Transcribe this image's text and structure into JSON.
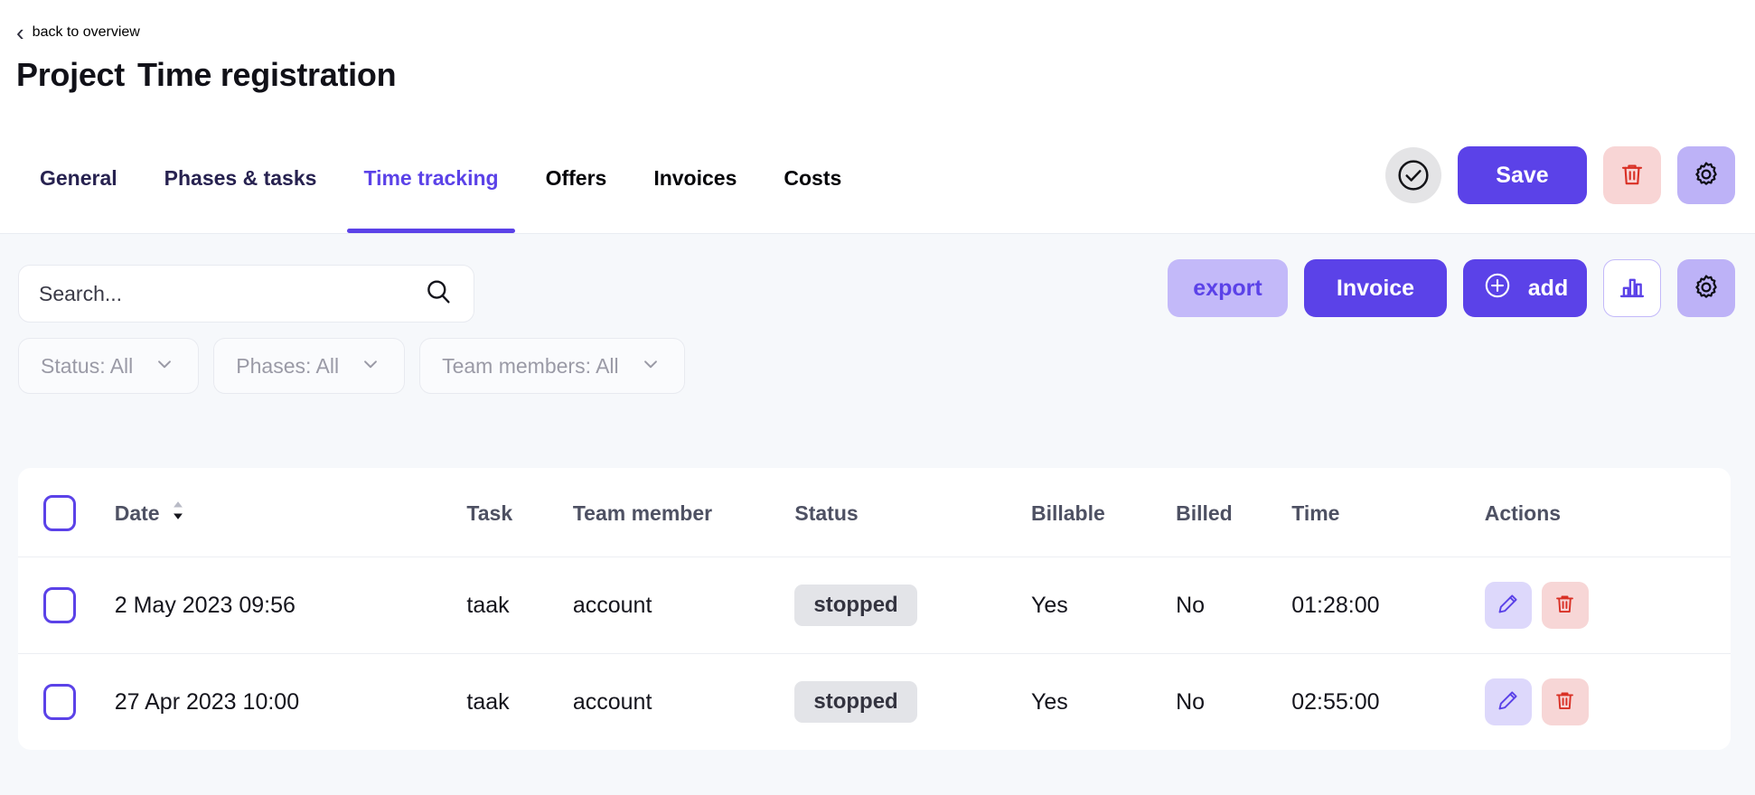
{
  "header": {
    "back_label": "back to overview",
    "back_icon": "chevron-left-icon",
    "title_prefix": "Project",
    "title_name": "Time registration",
    "tabs": [
      {
        "label": "General",
        "active": false,
        "style": "navy"
      },
      {
        "label": "Phases & tasks",
        "active": false,
        "style": "navy"
      },
      {
        "label": "Time tracking",
        "active": true,
        "style": "accent"
      },
      {
        "label": "Offers",
        "active": false,
        "style": "black"
      },
      {
        "label": "Invoices",
        "active": false,
        "style": "black"
      },
      {
        "label": "Costs",
        "active": false,
        "style": "black"
      }
    ],
    "actions": {
      "status_icon": "check-circle-icon",
      "save_label": "Save",
      "delete_icon": "trash-icon",
      "settings_icon": "gear-icon"
    }
  },
  "toolbar": {
    "search": {
      "value": "",
      "placeholder": "Search...",
      "icon": "search-icon"
    },
    "filters": [
      {
        "label": "Status: All",
        "icon": "chevron-down-icon"
      },
      {
        "label": "Phases: All",
        "icon": "chevron-down-icon"
      },
      {
        "label": "Team members: All",
        "icon": "chevron-down-icon"
      }
    ],
    "export_label": "export",
    "invoice_label": "Invoice",
    "add_label": "add",
    "add_icon": "plus-circle-icon",
    "chart_icon": "bar-chart-icon",
    "settings_icon": "gear-icon"
  },
  "table": {
    "select_all_checked": false,
    "columns": [
      {
        "key": "check",
        "label": ""
      },
      {
        "key": "date",
        "label": "Date",
        "sortable": true,
        "sort_icon": "sort-updown-icon"
      },
      {
        "key": "task",
        "label": "Task"
      },
      {
        "key": "member",
        "label": "Team member"
      },
      {
        "key": "status",
        "label": "Status"
      },
      {
        "key": "billable",
        "label": "Billable"
      },
      {
        "key": "billed",
        "label": "Billed"
      },
      {
        "key": "time",
        "label": "Time"
      },
      {
        "key": "actions",
        "label": "Actions"
      }
    ],
    "rows": [
      {
        "checked": false,
        "date": "2 May 2023 09:56",
        "task": "taak",
        "member": "account",
        "status": "stopped",
        "billable": "Yes",
        "billed": "No",
        "time": "01:28:00",
        "edit_icon": "pencil-icon",
        "delete_icon": "trash-icon"
      },
      {
        "checked": false,
        "date": "27 Apr 2023 10:00",
        "task": "taak",
        "member": "account",
        "status": "stopped",
        "billable": "Yes",
        "billed": "No",
        "time": "02:55:00",
        "edit_icon": "pencil-icon",
        "delete_icon": "trash-icon"
      }
    ]
  },
  "colors": {
    "accent": "#5b42e8",
    "accent_light": "#c3b9f9",
    "accent_lighter": "#ddd8fb",
    "danger": "#d93025",
    "danger_bg": "#f7d6d6",
    "page_bg": "#f6f8fb",
    "tab_navy": "#272250",
    "badge_bg": "#e3e4e8"
  }
}
